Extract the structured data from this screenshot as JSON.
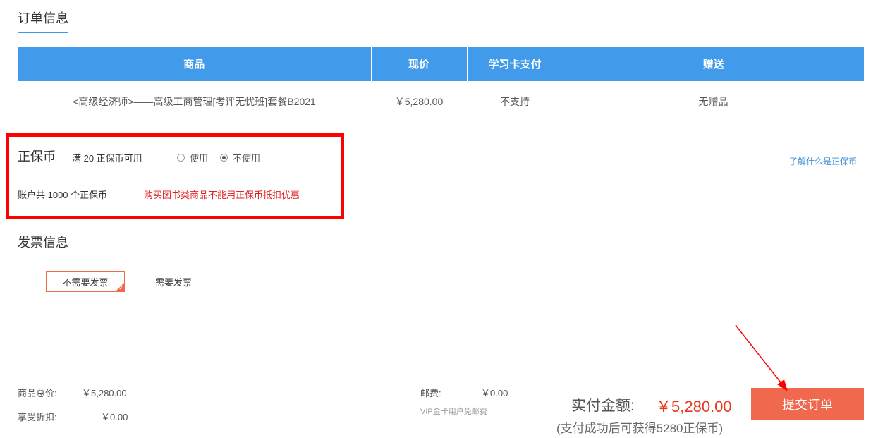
{
  "order_info": {
    "title": "订单信息",
    "headers": [
      "商品",
      "现价",
      "学习卡支付",
      "赠送"
    ],
    "rows": [
      {
        "product": "<高级经济师>——高级工商管理[考评无忧班]套餐B2021",
        "price": "￥5,280.00",
        "card_pay": "不支持",
        "gift": "无赠品"
      }
    ]
  },
  "coin": {
    "title": "正保币",
    "available_text": "满 20 正保币可用",
    "options": [
      "使用",
      "不使用"
    ],
    "selected_option": "不使用",
    "balance_text": "账户共 1000 个正保币",
    "warning": "购买图书类商品不能用正保币抵扣优惠",
    "learn_link": "了解什么是正保币"
  },
  "invoice": {
    "title": "发票信息",
    "options": [
      "不需要发票",
      "需要发票"
    ],
    "selected": "不需要发票"
  },
  "summary": {
    "goods_total_label": "商品总价:",
    "goods_total_value": "￥5,280.00",
    "discount_label": "享受折扣:",
    "discount_value": "￥0.00",
    "shipping_label": "邮费:",
    "shipping_value": "￥0.00",
    "vip_note": "VIP金卡用户免邮费",
    "pay_label": "实付金额:",
    "pay_amount": "￥5,280.00",
    "earn_note": "(支付成功后可获得5280正保币)",
    "submit_label": "提交订单"
  },
  "colors": {
    "table_header": "#429bea",
    "accent_blue": "#3e9be9",
    "highlight_frame": "#ff0000",
    "submit_button": "#f0684d",
    "amount_red": "#e8371e"
  }
}
